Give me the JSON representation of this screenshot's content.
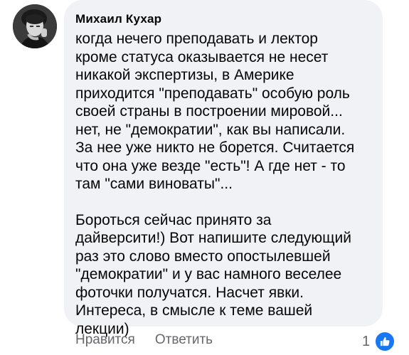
{
  "comment": {
    "author": "Михаил Кухар",
    "paragraphs": [
      "когда нечего преподавать и лектор\nкроме статуса оказывается не несет\nникакой экспертизы, в Америке\nприходится \"преподавать\" особую роль\nсвоей страны в построении мировой...\nнет, не \"демократии\", как вы написали.\nЗа нее уже никто не борется. Считается\nчто она уже везде \"есть\"! А где нет - то\nтам \"сами виноваты\"...",
      "Бороться сейчас принято за\nдайверсити!) Вот напишите следующий\nраз это слово вместо опостылевшей\n\"демократии\" и у вас намного веселее\nфоточки получатся. Насчет явки.\nИнтереса, в смысле к теме вашей\nлекции)"
    ]
  },
  "actions": {
    "like_label": "Нравится",
    "reply_label": "Ответить"
  },
  "reactions": {
    "count": "1",
    "icon": "thumbs-up-icon",
    "color": "#1877f2"
  }
}
